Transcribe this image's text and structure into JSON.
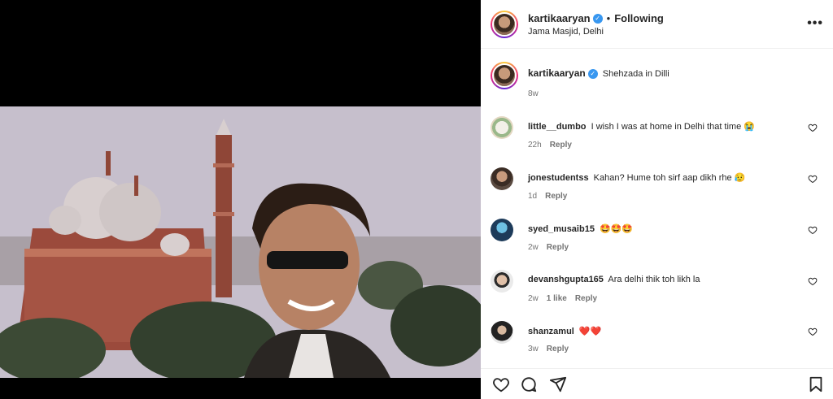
{
  "post": {
    "username": "kartikaaryan",
    "follow_status": "Following",
    "location": "Jama Masjid, Delhi",
    "caption": "Shehzada in Dilli",
    "caption_time": "8w"
  },
  "comments": [
    {
      "username": "little__dumbo",
      "text": "I wish I was at home in Delhi that time 😭",
      "time": "22h",
      "likes": "",
      "reply": "Reply"
    },
    {
      "username": "jonestudentss",
      "text": "Kahan? Hume toh sirf aap dikh rhe 😥",
      "time": "1d",
      "likes": "",
      "reply": "Reply"
    },
    {
      "username": "syed_musaib15",
      "text": "🤩🤩🤩",
      "time": "2w",
      "likes": "",
      "reply": "Reply"
    },
    {
      "username": "devanshgupta165",
      "text": "Ara delhi thik toh likh la",
      "time": "2w",
      "likes": "1 like",
      "reply": "Reply"
    },
    {
      "username": "shanzamul",
      "text": "❤️❤️",
      "time": "3w",
      "likes": "",
      "reply": "Reply"
    }
  ],
  "colors": {
    "verified": "#3897f0",
    "meta": "#737373",
    "text": "#262626"
  },
  "icons": {
    "like": "heart-icon",
    "comment": "comment-icon",
    "share": "share-icon",
    "save": "bookmark-icon",
    "more": "more-options-icon"
  }
}
